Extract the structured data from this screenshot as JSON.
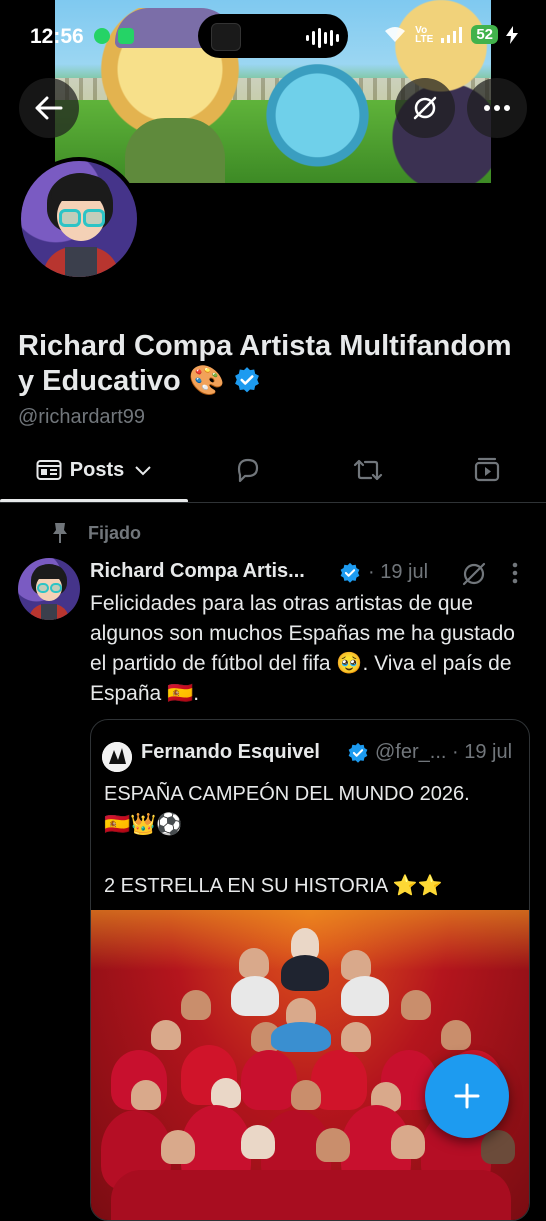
{
  "status_bar": {
    "time": "12:56",
    "network": "Vo\nLTE",
    "battery": "52"
  },
  "header": {
    "back_icon": "arrow-left-icon",
    "grok_icon": "grok-icon",
    "more_icon": "more-horizontal-icon"
  },
  "profile": {
    "display_name": "Richard Compa Artista Multifandom y Educativo",
    "name_emoji": "🎨",
    "handle": "@richardart99",
    "verified": true,
    "accent_color": "#1d9bf0"
  },
  "tabs": [
    {
      "label": "Posts",
      "icon": "posts-icon",
      "active": true,
      "has_dropdown": true
    },
    {
      "label": "",
      "icon": "reply-bubble-icon"
    },
    {
      "label": "",
      "icon": "retweet-icon"
    },
    {
      "label": "",
      "icon": "video-icon"
    }
  ],
  "pinned": {
    "label": "Fijado"
  },
  "tweet": {
    "author_name": "Richard Compa Artis...",
    "date": "· 19 jul",
    "text": "Felicidades para las otras artistas de que algunos son muchos Españas me ha gustado el partido de fútbol del fifa 🥹. Viva el país de España 🇪🇸.",
    "quote": {
      "author_name": "Fernando Esquivel",
      "handle": "@fer_...",
      "date": "· 19 jul",
      "line1": "ESPAÑA CAMPEÓN DEL MUNDO 2026.",
      "emojis": "🇪🇸👑⚽",
      "line2": "2 ESTRELLA EN SU HISTORIA ⭐⭐"
    }
  },
  "fab": {
    "icon": "plus-icon"
  }
}
